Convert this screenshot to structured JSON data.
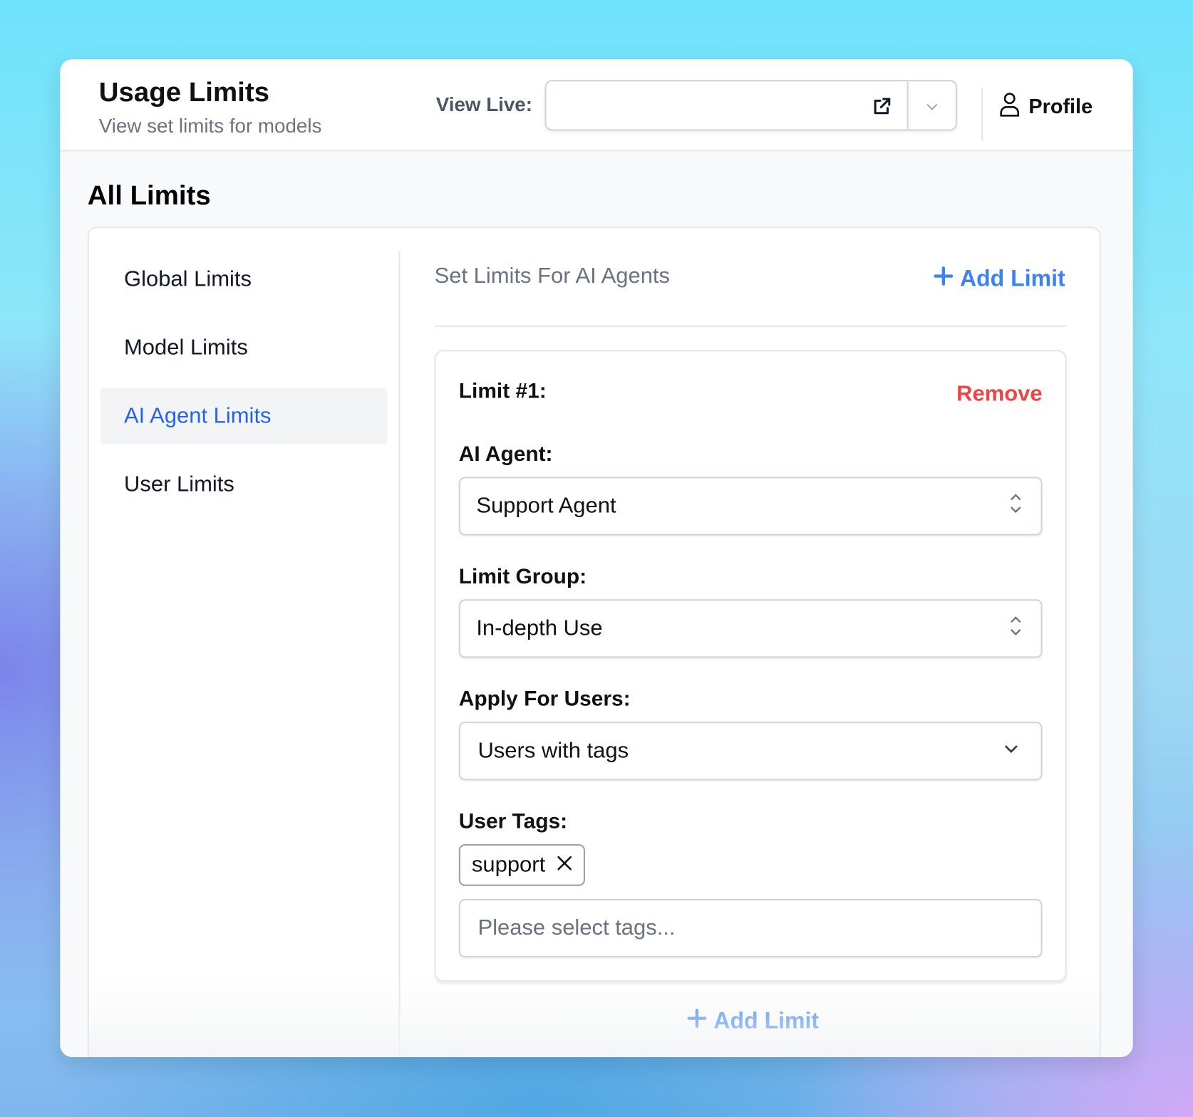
{
  "header": {
    "title": "Usage Limits",
    "subtitle": "View set limits for models",
    "view_live_label": "View Live:",
    "view_live_value": "",
    "profile_label": "Profile"
  },
  "main": {
    "heading": "All Limits"
  },
  "sidebar": {
    "items": [
      {
        "label": "Global Limits",
        "active": false
      },
      {
        "label": "Model Limits",
        "active": false
      },
      {
        "label": "AI Agent Limits",
        "active": true
      },
      {
        "label": "User Limits",
        "active": false
      }
    ]
  },
  "content": {
    "section_title": "Set Limits For AI Agents",
    "add_limit_label": "Add Limit",
    "limits": [
      {
        "title": "Limit #1:",
        "remove_label": "Remove",
        "ai_agent_label": "AI Agent:",
        "ai_agent_value": "Support Agent",
        "limit_group_label": "Limit Group:",
        "limit_group_value": "In-depth Use",
        "apply_for_users_label": "Apply For Users:",
        "apply_for_users_value": "Users with tags",
        "user_tags_label": "User Tags:",
        "tags": [
          "support"
        ],
        "tags_placeholder": "Please select tags..."
      }
    ],
    "bottom_add_limit_label": "Add Limit"
  },
  "colors": {
    "accent": "#3b82f6",
    "active": "#2563eb",
    "danger": "#ef4444"
  }
}
